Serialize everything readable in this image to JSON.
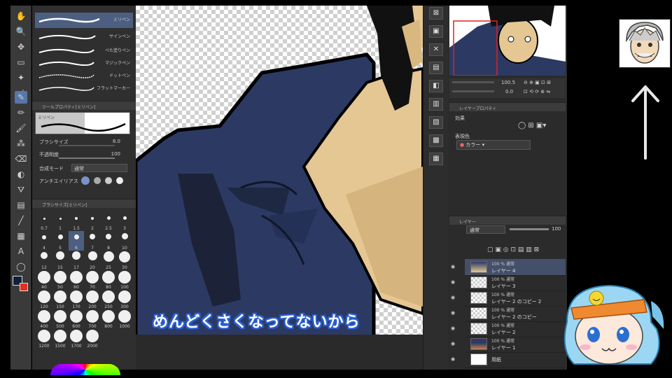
{
  "brushes": [
    {
      "name": "ミリペン",
      "selected": true
    },
    {
      "name": "サインペン"
    },
    {
      "name": "べた塗りペン"
    },
    {
      "name": "マジックペン"
    },
    {
      "name": "ドットペン"
    },
    {
      "name": "フラットマーカー"
    }
  ],
  "tool_property": {
    "header": "ツールプロパティ[ミリペン]",
    "preview_label": "ミリペン",
    "brush_size_label": "ブラシサイズ",
    "brush_size_value": "8.0",
    "opacity_label": "不透明度",
    "opacity_value": "100",
    "blend_mode_label": "合成モード",
    "blend_mode_value": "通常",
    "antialias_label": "アンチエイリアス"
  },
  "brush_size_panel": {
    "header": "ブラシサイズ[ミリペン]",
    "sizes": [
      "0.7",
      "1",
      "1.5",
      "2",
      "2.5",
      "3",
      "4",
      "5",
      "6",
      "7",
      "8",
      "10",
      "12",
      "15",
      "17",
      "20",
      "25",
      "30",
      "40",
      "50",
      "60",
      "70",
      "80",
      "100",
      "120",
      "150",
      "170",
      "200",
      "250",
      "300",
      "400",
      "500",
      "600",
      "700",
      "800",
      "1000",
      "1200",
      "1500",
      "1700",
      "2000"
    ],
    "selected": "6"
  },
  "subtitle": "めんどくさくなってないから",
  "navigator": {
    "zoom": "100.5",
    "rotation": "0.0"
  },
  "layer_property": {
    "header": "レイヤープロパティ",
    "effect_label": "効果",
    "color_label": "表現色",
    "color_value": "カラー"
  },
  "layer_panel": {
    "header": "レイヤー",
    "blend_mode": "通常",
    "opacity": "100",
    "layers": [
      {
        "blend": "100 % 通常",
        "name": "レイヤー 4",
        "selected": true
      },
      {
        "blend": "100 % 通常",
        "name": "レイヤー 3"
      },
      {
        "blend": "100 % 通常",
        "name": "レイヤー 2 のコピー 2"
      },
      {
        "blend": "100 % 通常",
        "name": "レイヤー 2 のコピー"
      },
      {
        "blend": "100 % 通常",
        "name": "レイヤー 2"
      },
      {
        "blend": "100 % 通常",
        "name": "レイヤー 1"
      },
      {
        "blend": "",
        "name": "用紙"
      }
    ]
  },
  "colors": {
    "jacket": "#2c3a63",
    "skin": "#e5c794",
    "hair": "#111111",
    "subtitle_outline": "#2a5fd0",
    "selection": "#44506a"
  }
}
